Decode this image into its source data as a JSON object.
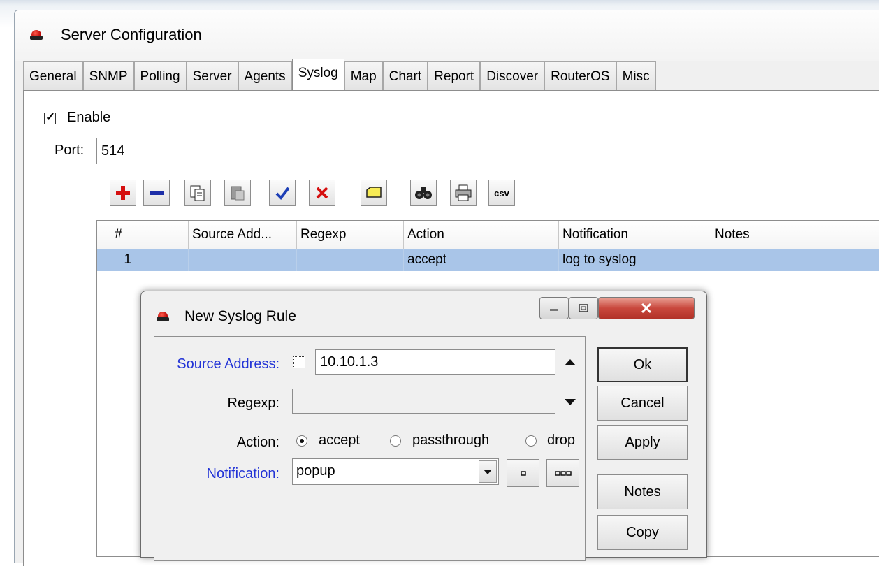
{
  "window": {
    "title": "Server Configuration"
  },
  "tabs": [
    "General",
    "SNMP",
    "Polling",
    "Server",
    "Agents",
    "Syslog",
    "Map",
    "Chart",
    "Report",
    "Discover",
    "RouterOS",
    "Misc"
  ],
  "active_tab": "Syslog",
  "syslog": {
    "enable_label": "Enable",
    "enable_checked": true,
    "port_label": "Port:",
    "port_value": "514"
  },
  "toolbar": {
    "icons": [
      "add-icon",
      "remove-icon",
      "copy-icon",
      "paste-icon",
      "enable-icon",
      "disable-icon",
      "comment-icon",
      "find-icon",
      "print-icon",
      "csv-icon"
    ],
    "csv_label": "csv"
  },
  "table": {
    "columns": [
      "#",
      "",
      "Source Add...",
      "Regexp",
      "Action",
      "Notification",
      "Notes"
    ],
    "rows": [
      {
        "num": "1",
        "flag": "",
        "source": "",
        "regexp": "",
        "action": "accept",
        "notification": "log to syslog",
        "notes": ""
      }
    ]
  },
  "dialog": {
    "title": "New Syslog Rule",
    "source_label": "Source Address:",
    "source_value": "10.10.1.3",
    "regexp_label": "Regexp:",
    "regexp_value": "",
    "action_label": "Action:",
    "action_options": [
      "accept",
      "passthrough",
      "drop"
    ],
    "action_selected": "accept",
    "notification_label": "Notification:",
    "notification_value": "popup",
    "buttons": {
      "ok": "Ok",
      "cancel": "Cancel",
      "apply": "Apply",
      "notes": "Notes",
      "copy": "Copy"
    }
  },
  "colors": {
    "selected_row": "#a9c5e8",
    "link_label": "#2233d6",
    "close_button": "#c9483d"
  }
}
